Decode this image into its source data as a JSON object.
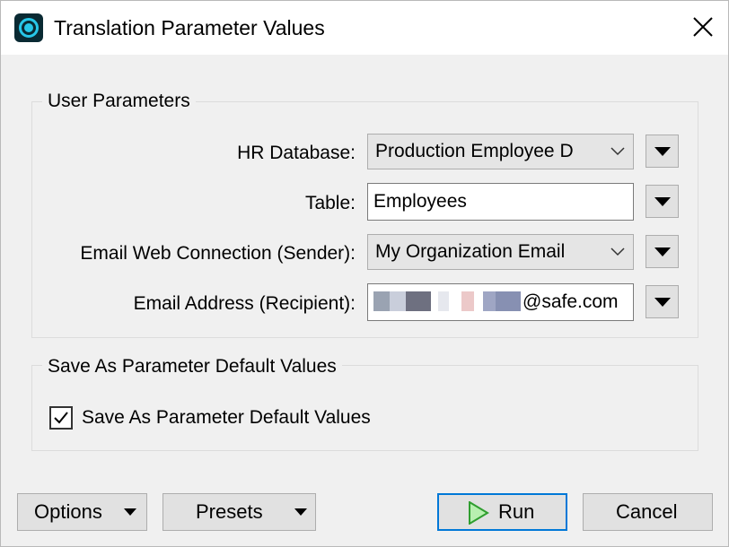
{
  "window": {
    "title": "Translation Parameter Values"
  },
  "user_parameters": {
    "group_label": "User Parameters",
    "params": [
      {
        "label": "HR Database:",
        "type": "combo",
        "value": "Production Employee D"
      },
      {
        "label": "Table:",
        "type": "text",
        "value": "Employees"
      },
      {
        "label": "Email Web Connection (Sender):",
        "type": "combo",
        "value": "My Organization Email"
      },
      {
        "label": "Email Address (Recipient):",
        "type": "text",
        "value": "@safe.com"
      }
    ]
  },
  "save_defaults": {
    "group_label": "Save As Parameter Default Values",
    "checkbox_label": "Save As Parameter Default Values",
    "checked": true
  },
  "buttons": {
    "options": "Options",
    "presets": "Presets",
    "run": "Run",
    "cancel": "Cancel"
  },
  "colors": {
    "accent": "#0078d7",
    "run_icon": "#35b835",
    "app_icon": "#27c7e8"
  },
  "icons": [
    "app-icon",
    "close-icon",
    "chevron-down-icon",
    "dropdown-arrow-icon",
    "checkmark-icon",
    "play-icon"
  ]
}
